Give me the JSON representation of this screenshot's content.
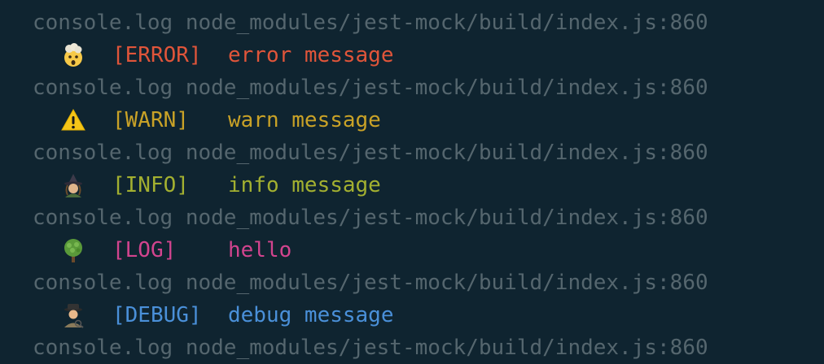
{
  "colors": {
    "background": "#0f2430",
    "source": "#55666e",
    "error": "#e0553a",
    "warn": "#c9a227",
    "info": "#a3b030",
    "log": "#d2448e",
    "debug": "#4a90d9"
  },
  "lines": [
    {
      "type": "source",
      "text": "console.log node_modules/jest-mock/build/index.js:860"
    },
    {
      "type": "entry",
      "icon": "exploding-head-icon",
      "level": "[ERROR]",
      "message": "error message"
    },
    {
      "type": "source",
      "text": "console.log node_modules/jest-mock/build/index.js:860"
    },
    {
      "type": "entry",
      "icon": "warning-sign-icon",
      "level": "[WARN]",
      "message": "warn message"
    },
    {
      "type": "source",
      "text": "console.log node_modules/jest-mock/build/index.js:860"
    },
    {
      "type": "entry",
      "icon": "witch-icon",
      "level": "[INFO]",
      "message": "info message"
    },
    {
      "type": "source",
      "text": "console.log node_modules/jest-mock/build/index.js:860"
    },
    {
      "type": "entry",
      "icon": "tree-icon",
      "level": "[LOG]",
      "message": "hello"
    },
    {
      "type": "source",
      "text": "console.log node_modules/jest-mock/build/index.js:860"
    },
    {
      "type": "entry",
      "icon": "detective-icon",
      "level": "[DEBUG]",
      "message": "debug message"
    },
    {
      "type": "source",
      "text": "console.log node_modules/jest-mock/build/index.js:860"
    }
  ]
}
